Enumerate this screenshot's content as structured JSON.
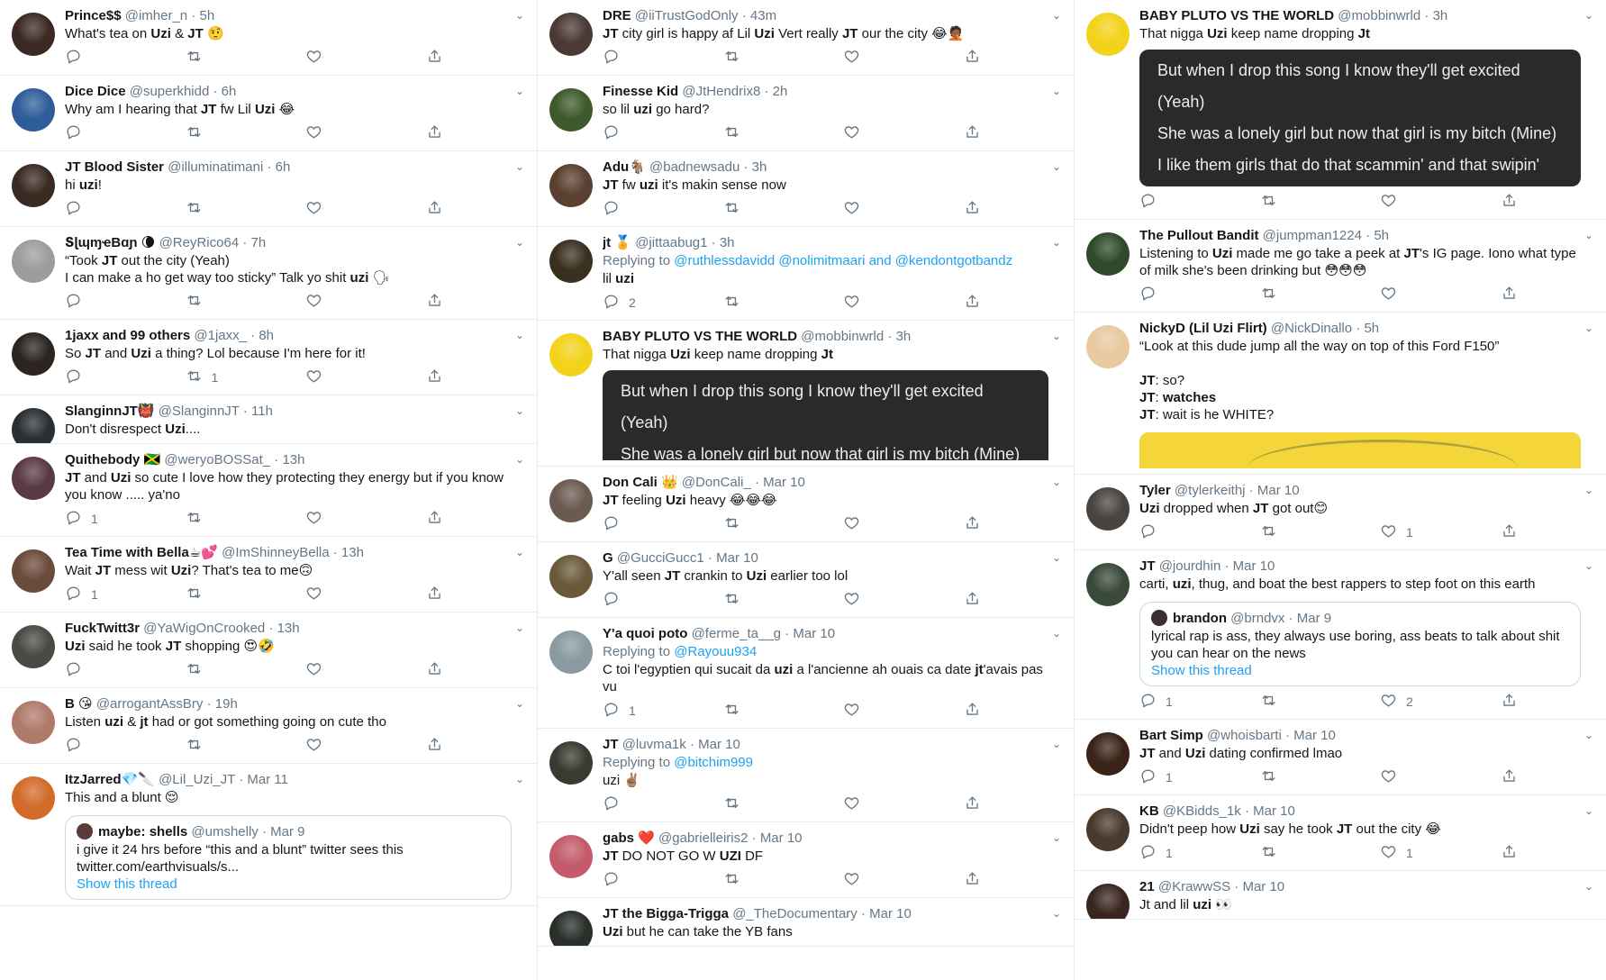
{
  "columns": [
    {
      "tweets": [
        {
          "name": "Prince$$",
          "handle": "@imher_n",
          "time": "5h",
          "avatar": "#3b2a24",
          "text": "What's tea on **Uzi** & **JT** 🤨",
          "reply": "",
          "retweet": "",
          "like": ""
        },
        {
          "name": "Dice Dice",
          "handle": "@superkhidd",
          "time": "6h",
          "avatar": "#2f5d9a",
          "text": "Why am I hearing that **JT** fw Lil **Uzi** 😂",
          "reply": "",
          "retweet": "",
          "like": ""
        },
        {
          "name": "JT Blood Sister",
          "handle": "@illuminatimani",
          "time": "6h",
          "avatar": "#3a2a22",
          "text": "hi **uzi**!",
          "reply": "",
          "retweet": "",
          "like": ""
        },
        {
          "name": "ՏɭɰɱҽBɑɲ 🌘",
          "handle": "@ReyRico64",
          "time": "7h",
          "avatar": "#9c9c9c",
          "text": "“Took **JT** out the city (Yeah)\nI can make a ho get way too sticky” Talk yo shit **uzi** 🗣",
          "reply": "",
          "retweet": "",
          "like": ""
        },
        {
          "name": "1jaxx and 99 others",
          "handle": "@1jaxx_",
          "time": "8h",
          "avatar": "#2b2420",
          "text": "So **JT** and **Uzi** a thing? Lol because I'm here for it!",
          "reply": "",
          "retweet": "1",
          "like": ""
        },
        {
          "name": "SlanginnJT👹",
          "handle": "@SlanginnJT",
          "time": "11h",
          "avatar": "#2a2f33",
          "text": "Don't disrespect **Uzi**....",
          "reply": "",
          "retweet": "",
          "like": "",
          "noActions": true
        },
        {
          "name": "Quithebody 🇯🇲",
          "handle": "@weryoBOSSat_",
          "time": "13h",
          "avatar": "#5a3a42",
          "text": "**JT** and **Uzi** so cute I love how they protecting they energy but if you know you know ..... ya'no",
          "reply": "1",
          "retweet": "",
          "like": ""
        },
        {
          "name": "Tea Time with Bella☕💕",
          "handle": "@ImShinneyBella",
          "time": "13h",
          "avatar": "#6a4a3a",
          "text": "Wait **JT** mess wit **Uzi**? That's tea to me🙃",
          "reply": "1",
          "retweet": "",
          "like": ""
        },
        {
          "name": "FuckTwitt3r",
          "handle": "@YaWigOnCrooked",
          "time": "13h",
          "avatar": "#4a4a44",
          "text": "**Uzi** said he took **JT** shopping 😍🤣",
          "reply": "",
          "retweet": "",
          "like": ""
        },
        {
          "name": "B 😘",
          "handle": "@arrogantAssBry",
          "time": "19h",
          "avatar": "#b07a6a",
          "text": "Listen **uzi** & **jt** had or got something going on cute tho",
          "reply": "",
          "retweet": "",
          "like": ""
        },
        {
          "name": "ItzJarred💎🔪",
          "handle": "@Lil_Uzi_JT",
          "time": "Mar 11",
          "avatar": "#d26a2a",
          "text": "This and a blunt 😌",
          "reply": "",
          "retweet": "",
          "like": "",
          "noActions": true,
          "quote": {
            "name": "maybe: shells",
            "handle": "@umshelly",
            "time": "Mar 9",
            "avatar": "#5a3a3a",
            "text": "i give it 24 hrs before “this and a blunt” twitter sees this\ntwitter.com/earthvisuals/s...",
            "link": "Show this thread"
          }
        }
      ]
    },
    {
      "tweets": [
        {
          "name": "DRE",
          "handle": "@iiTrustGodOnly",
          "time": "43m",
          "avatar": "#4a3a36",
          "text": "**JT** city girl is happy af Lil **Uzi** Vert really **JT** our the city 😂🤦🏾",
          "reply": "",
          "retweet": "",
          "like": ""
        },
        {
          "name": "Finesse Kid",
          "handle": "@JtHendrix8",
          "time": "2h",
          "avatar": "#3d5a2c",
          "text": "so lil **uzi** go hard?",
          "reply": "",
          "retweet": "",
          "like": ""
        },
        {
          "name": "Adu🐐",
          "handle": "@badnewsadu",
          "time": "3h",
          "avatar": "#5a4030",
          "text": "**JT** fw **uzi** it's makin sense now",
          "reply": "",
          "retweet": "",
          "like": ""
        },
        {
          "name": "jt 🏅",
          "handle": "@jittaabug1",
          "time": "3h",
          "avatar": "#3a3020",
          "replyTo": {
            "prefix": "Replying to ",
            "names": "@ruthlessdavidd @nolimitmaari and @kendontgotbandz"
          },
          "text": "lil **uzi**",
          "reply": "2",
          "retweet": "",
          "like": ""
        },
        {
          "name": "BABY PLUTO VS THE WORLD",
          "handle": "@mobbinwrld",
          "time": "3h",
          "avatar": "#f2d21a",
          "text": "That nigga **Uzi** keep name dropping **Jt**",
          "reply": "",
          "retweet": "",
          "like": "",
          "noActions": true,
          "lyricCut": true,
          "lyrics": [
            "But when I drop this song I know they'll get excited",
            "(Yeah)",
            "She was a lonely girl but now that girl is my bitch (Mine)"
          ]
        },
        {
          "name": "Don Cali 👑",
          "handle": "@DonCali_",
          "time": "Mar 10",
          "avatar": "#6a5a50",
          "text": "**JT** feeling **Uzi** heavy 😂😂😂",
          "reply": "",
          "retweet": "",
          "like": ""
        },
        {
          "name": "G",
          "handle": "@GucciGucc1",
          "time": "Mar 10",
          "avatar": "#6a5a3a",
          "text": "Y'all seen **JT** crankin to **Uzi** earlier too lol",
          "reply": "",
          "retweet": "",
          "like": ""
        },
        {
          "name": "Y'a quoi poto",
          "handle": "@ferme_ta__g",
          "time": "Mar 10",
          "avatar": "#8a9aa0",
          "replyTo": {
            "prefix": "Replying to ",
            "names": "@Rayouu934"
          },
          "text": "C toi l'egyptien qui sucait da **uzi** a l'ancienne ah ouais ca date **jt**'avais pas vu",
          "reply": "1",
          "retweet": "",
          "like": ""
        },
        {
          "name": "JT",
          "handle": "@luvma1k",
          "time": "Mar 10",
          "avatar": "#3a3a30",
          "replyTo": {
            "prefix": "Replying to ",
            "names": "@bitchim999"
          },
          "text": "uzi ✌🏽",
          "reply": "",
          "retweet": "",
          "like": ""
        },
        {
          "name": "gabs ❤️",
          "handle": "@gabrielleiris2",
          "time": "Mar 10",
          "avatar": "#c45a6a",
          "text": "**JT** DO NOT GO W **UZI** DF",
          "reply": "",
          "retweet": "",
          "like": ""
        },
        {
          "name": "JT the Bigga-Trigga",
          "handle": "@_TheDocumentary",
          "time": "Mar 10",
          "avatar": "#2a2f2a",
          "text": "**Uzi** but he can take the YB fans",
          "reply": "",
          "retweet": "",
          "like": "",
          "noActions": true
        }
      ]
    },
    {
      "tweets": [
        {
          "name": "BABY PLUTO VS THE WORLD",
          "handle": "@mobbinwrld",
          "time": "3h",
          "avatar": "#f2d21a",
          "text": "That nigga **Uzi** keep name dropping **Jt**",
          "reply": "",
          "retweet": "",
          "like": "",
          "lyrics": [
            "But when I drop this song I know they'll get excited",
            "(Yeah)",
            "She was a lonely girl but now that girl is my bitch (Mine)",
            "I like them girls that do that scammin' and that swipin'"
          ]
        },
        {
          "name": "The Pullout Bandit",
          "handle": "@jumpman1224",
          "time": "5h",
          "avatar": "#2f4a2a",
          "text": "Listening to **Uzi** made me go take a peek at **JT**'s IG page. Iono what type of milk she's been drinking but 😳😳😳",
          "reply": "",
          "retweet": "",
          "like": ""
        },
        {
          "name": "NickyD (Lil Uzi Flirt)",
          "handle": "@NickDinallo",
          "time": "5h",
          "avatar": "#e8c9a0",
          "text": "“Look at this dude jump all the way on top of this Ford F150”\n\n**JT**: so?\n**JT**: **watches**\n**JT**: wait is he WHITE?",
          "reply": "",
          "retweet": "",
          "like": "",
          "noActions": true,
          "mediaStrip": true
        },
        {
          "name": "Tyler",
          "handle": "@tylerkeithj",
          "time": "Mar 10",
          "avatar": "#4a4440",
          "text": "**Uzi** dropped when **JT** got out😊",
          "reply": "",
          "retweet": "",
          "like": "1"
        },
        {
          "name": "JT",
          "handle": "@jourdhin",
          "time": "Mar 10",
          "avatar": "#3a4a3a",
          "text": "carti, **uzi**, thug, and boat the best rappers to step foot on this earth",
          "reply": "1",
          "retweet": "",
          "like": "2",
          "quote": {
            "name": "brandon",
            "handle": "@brndvx",
            "time": "Mar 9",
            "avatar": "#3a3030",
            "text": "lyrical rap is ass, they always use boring, ass beats to talk about shit you can hear on the news",
            "link": "Show this thread"
          }
        },
        {
          "name": "Bart Simp",
          "handle": "@whoisbarti",
          "time": "Mar 10",
          "avatar": "#3a2418",
          "text": "**JT** and **Uzi** dating confirmed lmao",
          "reply": "1",
          "retweet": "",
          "like": ""
        },
        {
          "name": "KB",
          "handle": "@KBidds_1k",
          "time": "Mar 10",
          "avatar": "#4a3a2e",
          "text": "Didn't peep how **Uzi** say he took **JT** out the city 😂",
          "reply": "1",
          "retweet": "",
          "like": "1"
        },
        {
          "name": "21",
          "handle": "@KrawwSS",
          "time": "Mar 10",
          "avatar": "#3a2620",
          "text": "Jt and lil **uzi** 👀",
          "reply": "",
          "retweet": "",
          "like": "",
          "noActions": true
        }
      ]
    }
  ]
}
